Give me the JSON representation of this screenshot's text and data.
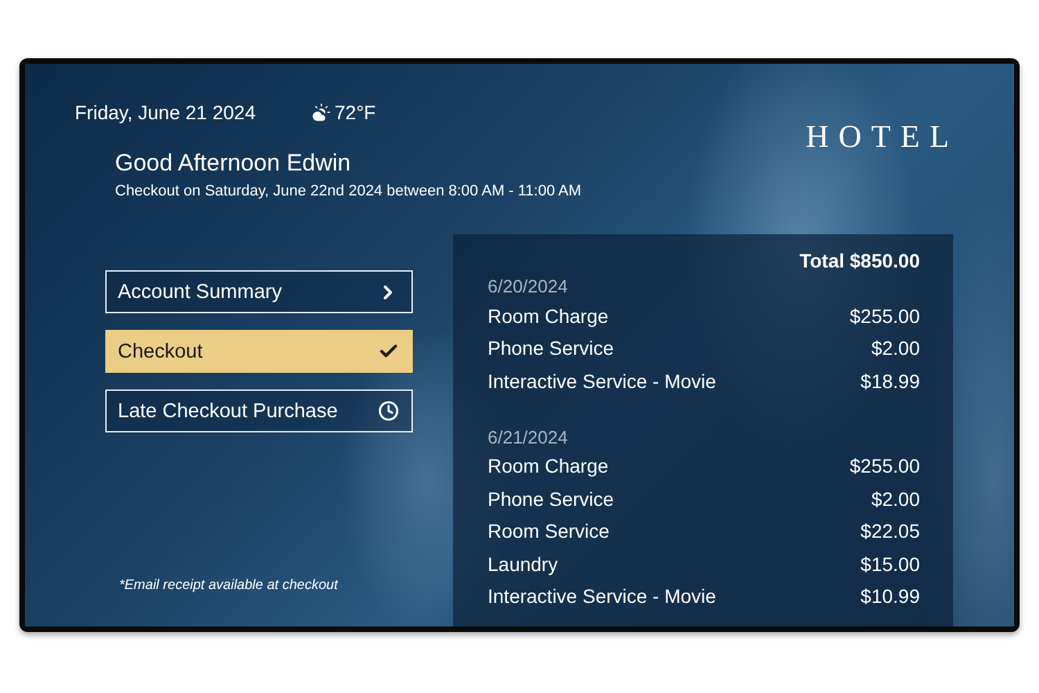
{
  "header": {
    "date": "Friday, June 21 2024",
    "temperature": "72°F",
    "logo": "HOTEL"
  },
  "greeting": {
    "title": "Good Afternoon Edwin",
    "subtitle": "Checkout on Saturday, June 22nd 2024 between 8:00 AM - 11:00 AM"
  },
  "menu": [
    {
      "label": "Account Summary",
      "selected": false,
      "kind": "chevron"
    },
    {
      "label": "Checkout",
      "selected": true,
      "kind": "check"
    },
    {
      "label": "Late Checkout Purchase",
      "selected": false,
      "kind": "clock"
    }
  ],
  "footnote": "*Email receipt available at checkout",
  "folio": {
    "total": "Total $850.00",
    "days": [
      {
        "date": "6/20/2024",
        "items": [
          {
            "name": "Room Charge",
            "amount": "$255.00"
          },
          {
            "name": "Phone Service",
            "amount": "$2.00"
          },
          {
            "name": "Interactive Service - Movie",
            "amount": "$18.99"
          }
        ]
      },
      {
        "date": "6/21/2024",
        "items": [
          {
            "name": "Room Charge",
            "amount": "$255.00"
          },
          {
            "name": "Phone Service",
            "amount": "$2.00"
          },
          {
            "name": "Room Service",
            "amount": "$22.05"
          },
          {
            "name": "Laundry",
            "amount": "$15.00"
          },
          {
            "name": "Interactive Service - Movie",
            "amount": "$10.99"
          }
        ]
      }
    ]
  }
}
